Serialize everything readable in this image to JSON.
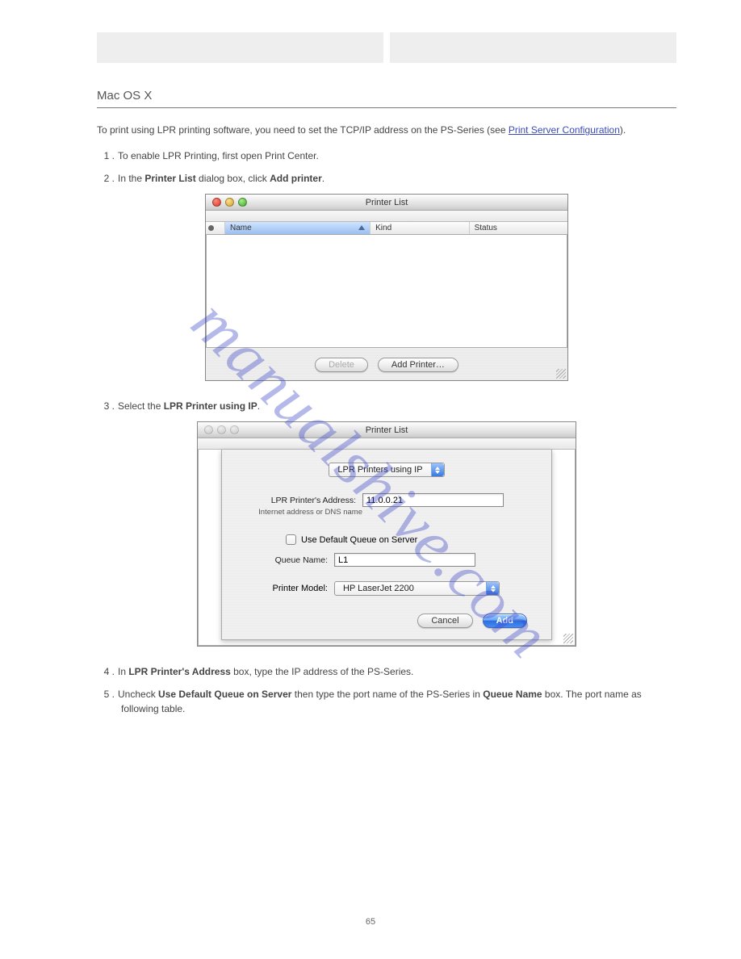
{
  "header": {
    "left_cell": "",
    "right_cell": ""
  },
  "section_title": "Mac OS X",
  "intro": {
    "pre": "To print using LPR printing software, you need to set the TCP/IP address on the PS-Series (see ",
    "link_text": "Print Server Configuration",
    "post": ")."
  },
  "steps": {
    "s1": {
      "num": "1 . ",
      "text": "To enable LPR Printing, first open Print Center."
    },
    "s2": {
      "num": "2 . ",
      "pre": "In the ",
      "b1": "Printer List",
      "mid": " dialog box, click ",
      "b2": "Add printer",
      "post": "."
    },
    "s3": {
      "num": "3 . ",
      "pre": "Select the ",
      "b1": "LPR Printer using IP",
      "post": "."
    },
    "s4": {
      "num": "4 . ",
      "pre": "In ",
      "b1": "LPR Printer's Address",
      "post": " box, type the IP address of the PS-Series."
    },
    "s5": {
      "num": "5 . ",
      "pre": "Uncheck ",
      "b1": "Use Default Queue on Server ",
      "mid": "then type the port name of the PS-Series in ",
      "b2": "Queue Name",
      "post": " box. The port name as following table."
    }
  },
  "printer_list_window": {
    "title": "Printer List",
    "cols": {
      "name": "Name",
      "kind": "Kind",
      "status": "Status"
    },
    "delete_btn": "Delete",
    "add_btn": "Add Printer…"
  },
  "sheet_window": {
    "title": "Printer List",
    "protocol": "LPR Printers using IP",
    "addr_label": "LPR Printer's Address:",
    "addr_value": "11.0.0.21",
    "addr_hint": "Internet address or DNS name",
    "queue_checkbox": "Use Default Queue on Server",
    "queue_label": "Queue Name:",
    "queue_value": "L1",
    "model_label": "Printer Model:",
    "model_value": "HP LaserJet 2200",
    "cancel_btn": "Cancel",
    "add_btn": "Add"
  },
  "watermark": "manualshive.com",
  "page_number": "65"
}
